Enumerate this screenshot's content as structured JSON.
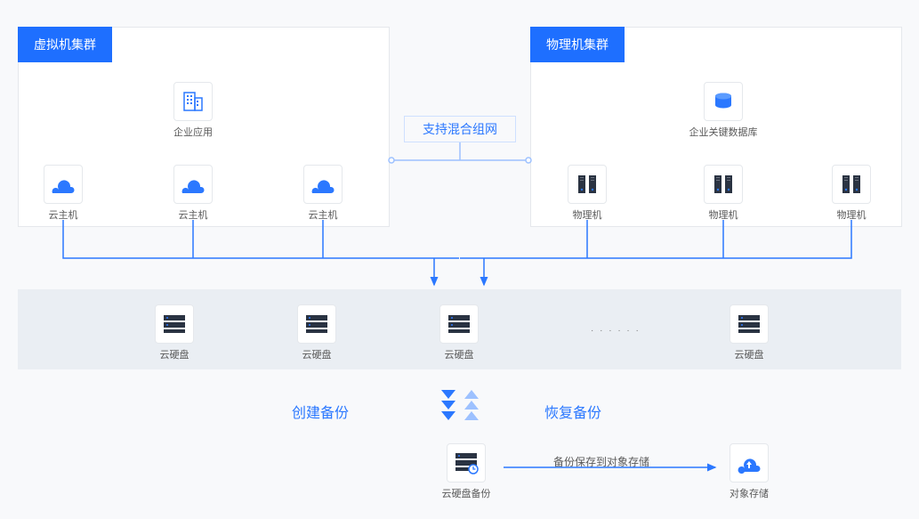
{
  "clusters": {
    "vm": {
      "title": "虚拟机集群"
    },
    "pm": {
      "title": "物理机集群"
    }
  },
  "nodes": {
    "enterprise_app": "企业应用",
    "enterprise_db": "企业关键数据库",
    "cloud_host": "云主机",
    "physical_host": "物理机",
    "cloud_disk": "云硬盘",
    "disk_backup": "云硬盘备份",
    "object_storage": "对象存储"
  },
  "labels": {
    "hybrid": "支持混合组网",
    "create_backup": "创建备份",
    "restore_backup": "恢复备份",
    "save_to_object": "备份保存到对象存储",
    "ellipsis": "· · · · · ·"
  },
  "colors": {
    "primary": "#2b78ff",
    "primary_light": "#9dc1ff",
    "dark": "#2a3342"
  }
}
